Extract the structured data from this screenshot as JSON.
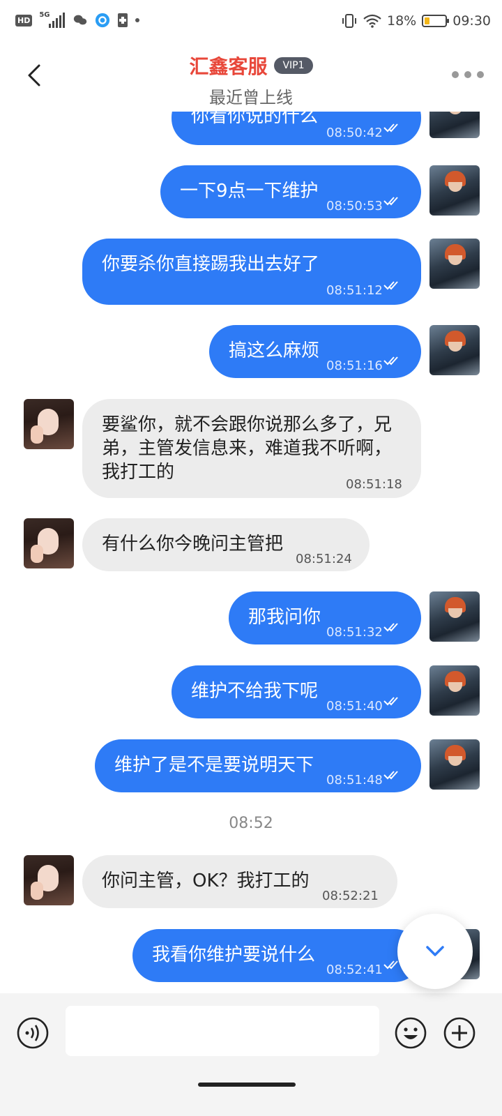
{
  "status_bar": {
    "hd": "HD",
    "network": "5G",
    "battery_percent": "18%",
    "time": "09:30",
    "icons": [
      "wechat-icon",
      "browser-icon",
      "sim-icon",
      "vibrate-icon",
      "wifi-icon",
      "battery-icon"
    ]
  },
  "header": {
    "title": "汇鑫客服",
    "badge": "VIP1",
    "subtitle": "最近曾上线"
  },
  "colors": {
    "out_bubble": "#2e7bf6",
    "in_bubble": "#ececec",
    "title": "#e8473a"
  },
  "messages": [
    {
      "side": "out",
      "text": "你看你说的什么",
      "time": "08:50:42"
    },
    {
      "side": "out",
      "text": "一下9点一下维护",
      "time": "08:50:53"
    },
    {
      "side": "out",
      "text": "你要杀你直接踢我出去好了",
      "time": "08:51:12"
    },
    {
      "side": "out",
      "text": "搞这么麻烦",
      "time": "08:51:16"
    },
    {
      "side": "in",
      "text": "要鲨你，就不会跟你说那么多了，兄弟，主管发信息来，难道我不听啊，我打工的",
      "time": "08:51:18"
    },
    {
      "side": "in",
      "text": "有什么你今晚问主管把",
      "time": "08:51:24"
    },
    {
      "side": "out",
      "text": "那我问你",
      "time": "08:51:32"
    },
    {
      "side": "out",
      "text": "维护不给我下呢",
      "time": "08:51:40"
    },
    {
      "side": "out",
      "text": "维护了是不是要说明天下",
      "time": "08:51:48"
    },
    {
      "side": "in",
      "text": "你问主管，OK？我打工的",
      "time": "08:52:21"
    },
    {
      "side": "out",
      "text": "我看你维护要说什么",
      "time": "08:52:41"
    }
  ],
  "time_divider": "08:52",
  "input": {
    "placeholder": ""
  }
}
